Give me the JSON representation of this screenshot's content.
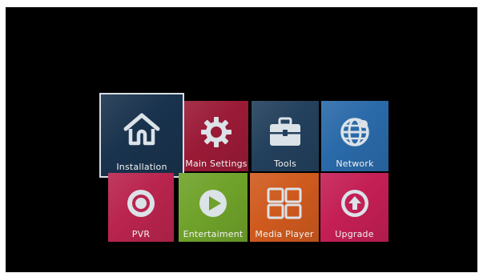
{
  "menu": {
    "tiles": [
      {
        "label": "Installation",
        "icon": "home-icon",
        "color": "#19324d",
        "selected": true
      },
      {
        "label": "Main Settings",
        "icon": "gear-icon",
        "color": "#9a1a36"
      },
      {
        "label": "Tools",
        "icon": "toolbox-icon",
        "color": "#23405c"
      },
      {
        "label": "Network",
        "icon": "globe-icon",
        "color": "#2a6aa9"
      },
      {
        "label": "PVR",
        "icon": "record-icon",
        "color": "#b9244e"
      },
      {
        "label": "Entertaiment",
        "icon": "play-icon",
        "color": "#6fa22a"
      },
      {
        "label": "Media Player",
        "icon": "grid-icon",
        "color": "#cf5a1e"
      },
      {
        "label": "Upgrade",
        "icon": "upgrade-arrow-icon",
        "color": "#c41f55"
      }
    ]
  },
  "colors": {
    "background": "#000000",
    "selection_border": "#d7dde3",
    "icon": "#dbe2e8",
    "label": "#f2f2f2"
  }
}
